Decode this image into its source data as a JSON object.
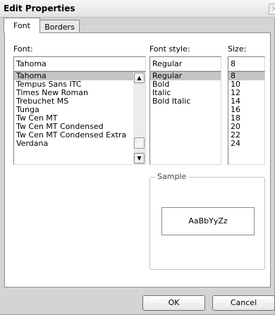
{
  "window": {
    "title": "Edit Properties",
    "close_glyph": "×"
  },
  "tabs": [
    {
      "label": "Font",
      "active": true
    },
    {
      "label": "Borders",
      "active": false
    }
  ],
  "font": {
    "label": "Font:",
    "value": "Tahoma",
    "options": [
      "Tahoma",
      "Tempus Sans ITC",
      "Times New Roman",
      "Trebuchet MS",
      "Tunga",
      "Tw Cen MT",
      "Tw Cen MT Condensed",
      "Tw Cen MT Condensed Extra",
      "Verdana"
    ],
    "selected": "Tahoma"
  },
  "font_style": {
    "label": "Font style:",
    "value": "Regular",
    "options": [
      "Regular",
      "Bold",
      "Italic",
      "Bold Italic"
    ],
    "selected": "Regular"
  },
  "size": {
    "label": "Size:",
    "value": "8",
    "options": [
      "8",
      "10",
      "12",
      "14",
      "16",
      "18",
      "20",
      "22",
      "24"
    ],
    "selected": "8"
  },
  "sample": {
    "label": "Sample",
    "text": "AaBbYyZz"
  },
  "buttons": {
    "ok": "OK",
    "cancel": "Cancel"
  },
  "icons": {
    "scroll_up": "▲",
    "scroll_down": "▼",
    "close": "close-icon"
  }
}
